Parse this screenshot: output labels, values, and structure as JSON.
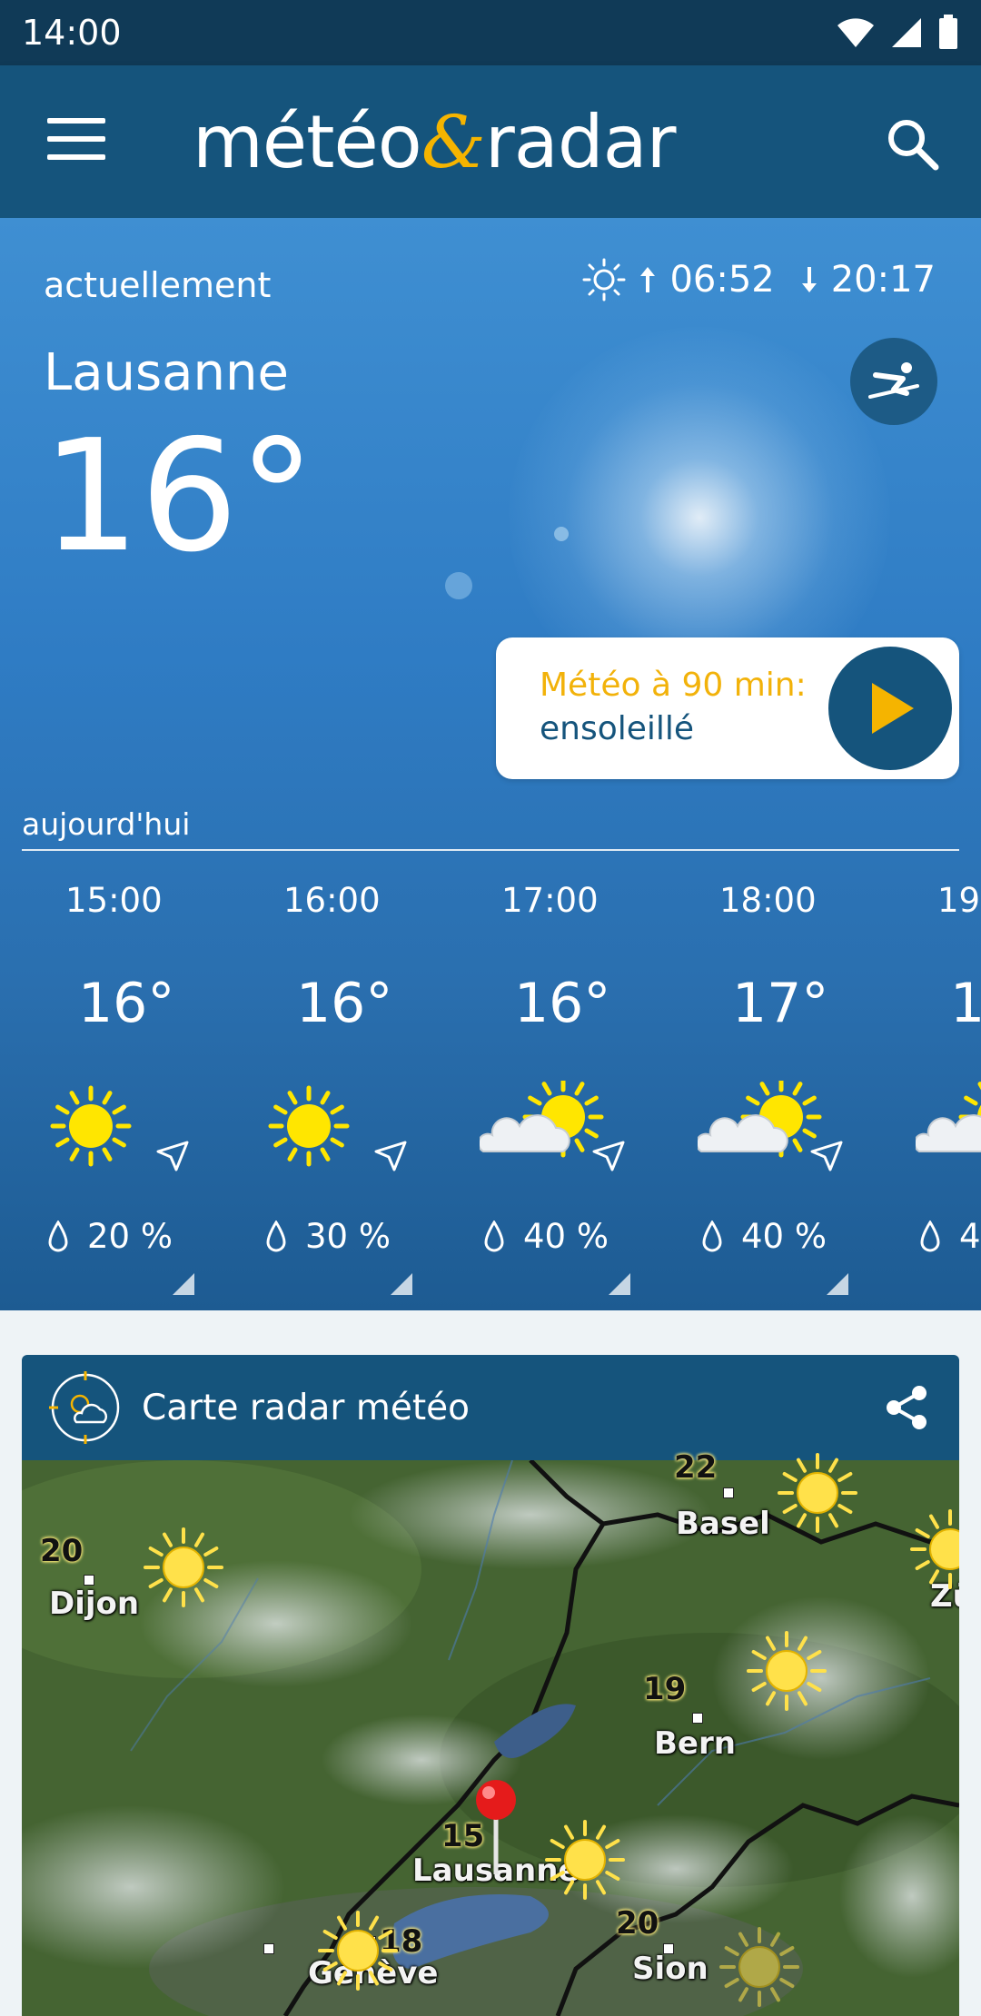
{
  "status_bar": {
    "time": "14:00"
  },
  "app": {
    "logo_left": "météo",
    "logo_amp": "&",
    "logo_right": "radar"
  },
  "current": {
    "label": "actuellement",
    "sunrise": "06:52",
    "sunset": "20:17",
    "city": "Lausanne",
    "temperature": "16°"
  },
  "nowcast": {
    "title": "Météo à 90 min:",
    "condition": "ensoleillé"
  },
  "today": {
    "label": "aujourd'hui",
    "hours": [
      {
        "time": "15:00",
        "temp": "16°",
        "icon": "sun-icon",
        "rain": "20 %"
      },
      {
        "time": "16:00",
        "temp": "16°",
        "icon": "sun-icon",
        "rain": "30 %"
      },
      {
        "time": "17:00",
        "temp": "16°",
        "icon": "partly-cloudy-icon",
        "rain": "40 %"
      },
      {
        "time": "18:00",
        "temp": "17°",
        "icon": "partly-cloudy-icon",
        "rain": "40 %"
      },
      {
        "time": "19:",
        "temp": "1",
        "icon": "partly-cloudy-icon",
        "rain": "4"
      }
    ]
  },
  "radar": {
    "title": "Carte radar météo",
    "cities": [
      "Basel",
      "Dijon",
      "Zü",
      "Bern",
      "Lausanne",
      "Sion",
      "Genève"
    ],
    "temps": [
      "22",
      "20",
      "19",
      "15",
      "18",
      "20"
    ]
  },
  "colors": {
    "brand": "#15547c",
    "accent": "#f2b20a",
    "status_bar": "#103a57"
  }
}
